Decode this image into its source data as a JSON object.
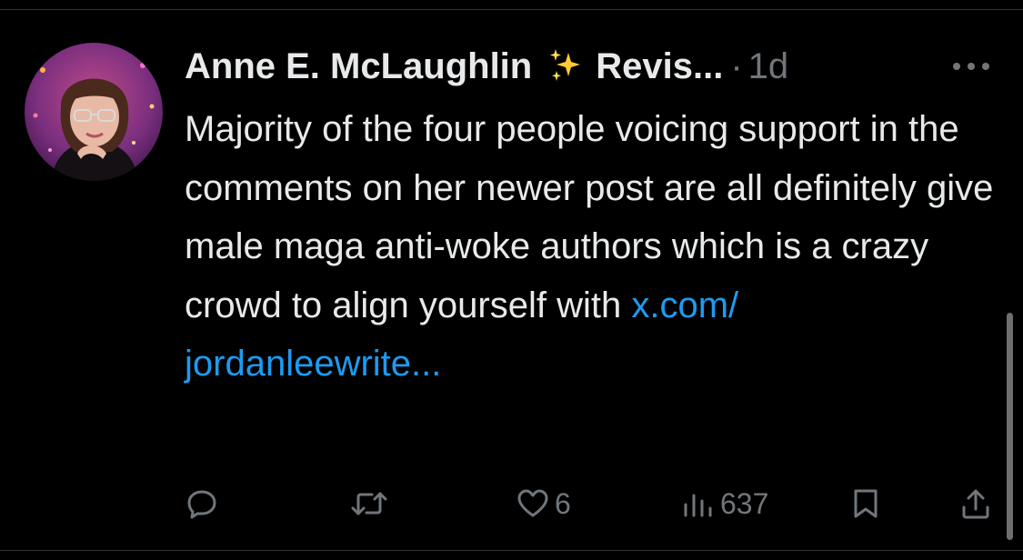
{
  "tweet": {
    "author": {
      "display_name": "Anne E. McLaughlin",
      "emoji_icon": "sparkles-emoji",
      "name_suffix": "Revis...",
      "avatar_icon": "avatar-photo"
    },
    "separator": "·",
    "timestamp": "1d",
    "more_icon": "more-horizontal-icon",
    "text": "Majority of the four people voicing support in the comments on her newer post are all definitely give male maga anti-woke authors which is a crazy crowd to align yourself with ",
    "link_text_1": "x.com/",
    "link_text_2": "jordanleewrite..."
  },
  "actions": {
    "reply": {
      "icon": "reply-icon",
      "count": ""
    },
    "retweet": {
      "icon": "retweet-icon",
      "count": ""
    },
    "like": {
      "icon": "heart-icon",
      "count": "6"
    },
    "views": {
      "icon": "analytics-icon",
      "count": "637"
    },
    "bookmark": {
      "icon": "bookmark-icon"
    },
    "share": {
      "icon": "share-icon"
    }
  },
  "colors": {
    "background": "#000000",
    "text": "#e7e9ea",
    "secondary": "#71767b",
    "link": "#1d9bf0",
    "divider": "#2f3336"
  }
}
